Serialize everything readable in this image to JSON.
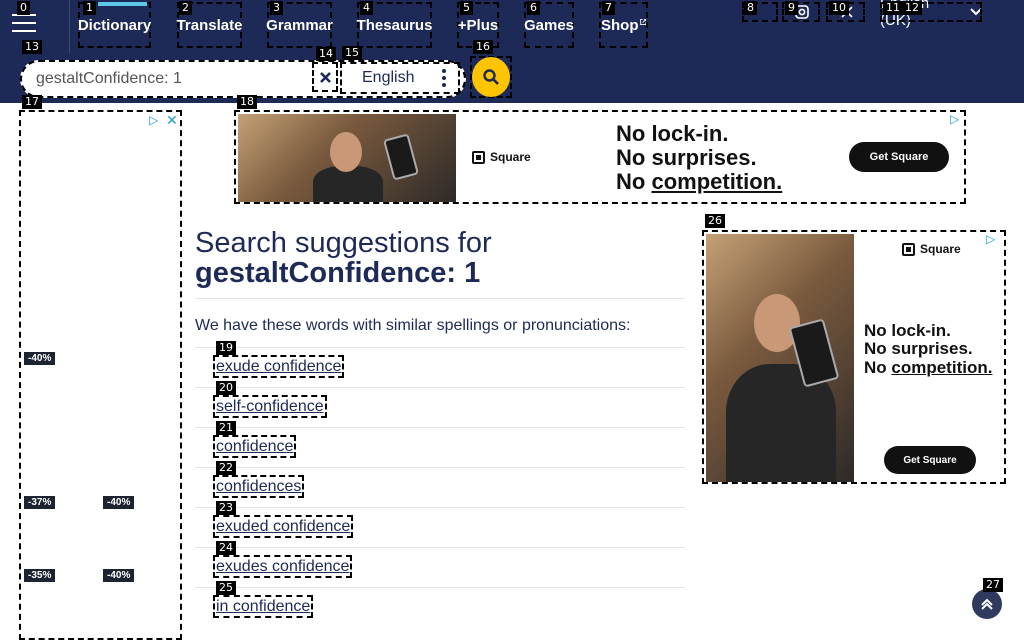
{
  "nav": {
    "menu_label": "",
    "items": [
      {
        "label": "Dictionary"
      },
      {
        "label": "Translate"
      },
      {
        "label": "Grammar"
      },
      {
        "label": "Thesaurus"
      },
      {
        "label": "+Plus"
      },
      {
        "label": "Games"
      },
      {
        "label": "Shop"
      }
    ],
    "language": "English (UK)"
  },
  "search": {
    "value": "gestaltConfidence: 1",
    "placeholder": "",
    "dictionary": "English"
  },
  "ads": {
    "brand": "Square",
    "line1": "No lock-in.",
    "line2": "No surprises.",
    "line3_prefix": "No ",
    "line3_em": "competition.",
    "cta": "Get Square",
    "discounts": [
      "-40%",
      "-37%",
      "-40%",
      "-35%",
      "-40%"
    ]
  },
  "results": {
    "title_prefix": "Search suggestions for",
    "title_query": "gestaltConfidence: 1",
    "intro": "We have these words with similar spellings or pronunciations:",
    "suggestions": [
      "exude confidence",
      "self-confidence",
      "confidence",
      "confidences",
      "exuded confidence",
      "exudes confidence",
      "in confidence"
    ]
  },
  "tags": [
    "0",
    "1",
    "2",
    "3",
    "4",
    "5",
    "6",
    "7",
    "8",
    "9",
    "10",
    "11",
    "12",
    "13",
    "14",
    "15",
    "16",
    "17",
    "18",
    "19",
    "20",
    "21",
    "22",
    "23",
    "24",
    "25",
    "26",
    "27"
  ],
  "colors": {
    "brand_navy": "#1d2a57",
    "accent_yellow": "#fec400",
    "active_blue": "#5ec6e8"
  }
}
